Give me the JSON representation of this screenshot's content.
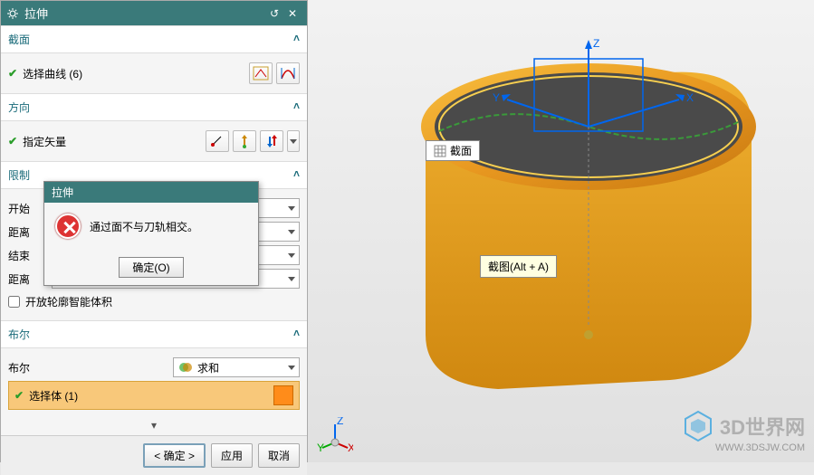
{
  "header": {
    "title": "拉伸",
    "reset": "↺",
    "close": "✕"
  },
  "sections": {
    "section": {
      "title": "截面",
      "select_curve": "选择曲线 (6)"
    },
    "direction": {
      "title": "方向",
      "specify_vector": "指定矢量"
    },
    "limit": {
      "title": "限制",
      "start": "开始",
      "distance1": "距离",
      "end": "结束",
      "distance2": "距离",
      "open_profile": "开放轮廓智能体积"
    },
    "boolean": {
      "title": "布尔",
      "label": "布尔",
      "value": "求和",
      "select_body": "选择体 (1)"
    }
  },
  "footer": {
    "ok": "< 确定 >",
    "apply": "应用",
    "cancel": "取消"
  },
  "dialog": {
    "title": "拉伸",
    "message": "通过面不与刀轨相交。",
    "ok": "确定(O)"
  },
  "viewport": {
    "section_tag": "截面",
    "tooltip": "截图(Alt + A)",
    "axes": {
      "x": "X",
      "y": "Y",
      "z": "Z"
    }
  },
  "triad_axes": {
    "x": "X",
    "y": "Y",
    "z": "Z"
  },
  "watermark": {
    "line1": "3D世界网",
    "line2": "WWW.3DSJW.COM"
  }
}
